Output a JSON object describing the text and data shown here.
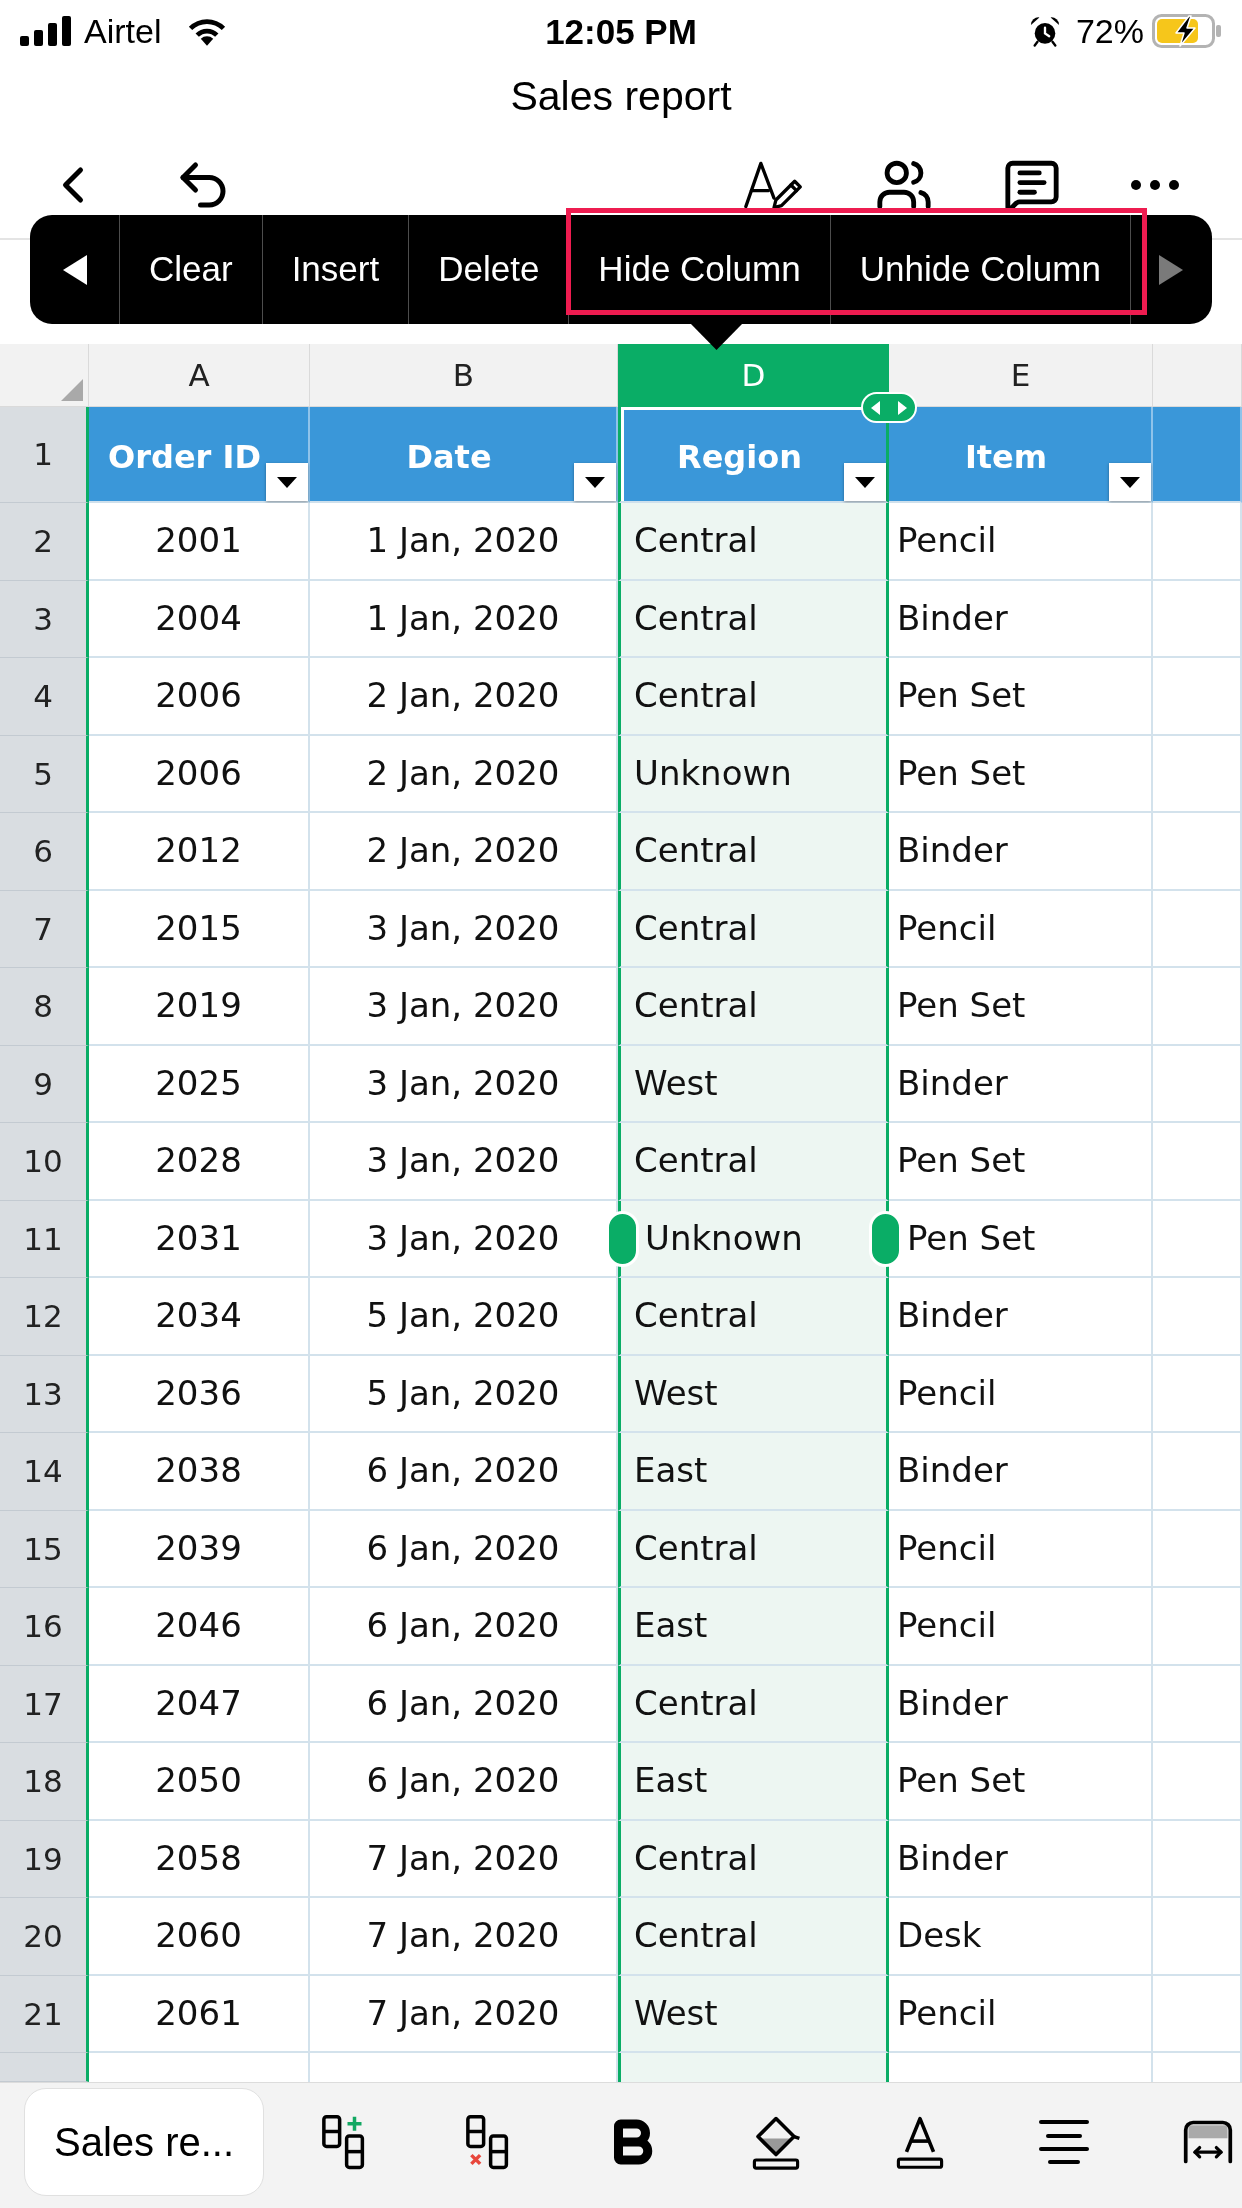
{
  "status_bar": {
    "carrier": "Airtel",
    "time": "12:05 PM",
    "battery": "72%"
  },
  "document": {
    "title": "Sales report"
  },
  "context_menu": {
    "scroll_left": {
      "disabled": false
    },
    "items": [
      {
        "label": "Clear",
        "highlighted": false
      },
      {
        "label": "Insert",
        "highlighted": false
      },
      {
        "label": "Delete",
        "highlighted": false
      },
      {
        "label": "Hide Column",
        "highlighted": true
      },
      {
        "label": "Unhide Column",
        "highlighted": true
      }
    ],
    "scroll_right": {
      "disabled": true
    }
  },
  "sheet": {
    "columns": [
      {
        "letter": "A",
        "selected": false
      },
      {
        "letter": "B",
        "selected": false
      },
      {
        "letter": "D",
        "selected": true
      },
      {
        "letter": "E",
        "selected": false
      },
      {
        "selected": false
      }
    ],
    "rows": [
      {
        "number": "1",
        "kind": "header",
        "handles": false,
        "cells": [
          "Order ID",
          "Date",
          "Region",
          "Item"
        ]
      },
      {
        "number": "2",
        "kind": "data",
        "handles": false,
        "cells": [
          "2001",
          "1 Jan, 2020",
          "Central",
          "Pencil"
        ]
      },
      {
        "number": "3",
        "kind": "data",
        "handles": false,
        "cells": [
          "2004",
          "1 Jan, 2020",
          "Central",
          "Binder"
        ]
      },
      {
        "number": "4",
        "kind": "data",
        "handles": false,
        "cells": [
          "2006",
          "2 Jan, 2020",
          "Central",
          "Pen Set"
        ]
      },
      {
        "number": "5",
        "kind": "data",
        "handles": false,
        "cells": [
          "2006",
          "2 Jan, 2020",
          "Unknown",
          "Pen Set"
        ]
      },
      {
        "number": "6",
        "kind": "data",
        "handles": false,
        "cells": [
          "2012",
          "2 Jan, 2020",
          "Central",
          "Binder"
        ]
      },
      {
        "number": "7",
        "kind": "data",
        "handles": false,
        "cells": [
          "2015",
          "3 Jan, 2020",
          "Central",
          "Pencil"
        ]
      },
      {
        "number": "8",
        "kind": "data",
        "handles": false,
        "cells": [
          "2019",
          "3 Jan, 2020",
          "Central",
          "Pen Set"
        ]
      },
      {
        "number": "9",
        "kind": "data",
        "handles": false,
        "cells": [
          "2025",
          "3 Jan, 2020",
          "West",
          "Binder"
        ]
      },
      {
        "number": "10",
        "kind": "data",
        "handles": false,
        "cells": [
          "2028",
          "3 Jan, 2020",
          "Central",
          "Pen Set"
        ]
      },
      {
        "number": "11",
        "kind": "data",
        "handles": true,
        "cells": [
          "2031",
          "3 Jan, 2020",
          "Unknown",
          "Pen Set"
        ]
      },
      {
        "number": "12",
        "kind": "data",
        "handles": false,
        "cells": [
          "2034",
          "5 Jan, 2020",
          "Central",
          "Binder"
        ]
      },
      {
        "number": "13",
        "kind": "data",
        "handles": false,
        "cells": [
          "2036",
          "5 Jan, 2020",
          "West",
          "Pencil"
        ]
      },
      {
        "number": "14",
        "kind": "data",
        "handles": false,
        "cells": [
          "2038",
          "6 Jan, 2020",
          "East",
          "Binder"
        ]
      },
      {
        "number": "15",
        "kind": "data",
        "handles": false,
        "cells": [
          "2039",
          "6 Jan, 2020",
          "Central",
          "Pencil"
        ]
      },
      {
        "number": "16",
        "kind": "data",
        "handles": false,
        "cells": [
          "2046",
          "6 Jan, 2020",
          "East",
          "Pencil"
        ]
      },
      {
        "number": "17",
        "kind": "data",
        "handles": false,
        "cells": [
          "2047",
          "6 Jan, 2020",
          "Central",
          "Binder"
        ]
      },
      {
        "number": "18",
        "kind": "data",
        "handles": false,
        "cells": [
          "2050",
          "6 Jan, 2020",
          "East",
          "Pen Set"
        ]
      },
      {
        "number": "19",
        "kind": "data",
        "handles": false,
        "cells": [
          "2058",
          "7 Jan, 2020",
          "Central",
          "Binder"
        ]
      },
      {
        "number": "20",
        "kind": "data",
        "handles": false,
        "cells": [
          "2060",
          "7 Jan, 2020",
          "Central",
          "Desk"
        ]
      },
      {
        "number": "21",
        "kind": "data",
        "handles": false,
        "cells": [
          "2061",
          "7 Jan, 2020",
          "West",
          "Pencil"
        ]
      }
    ]
  },
  "sheet_tabs": [
    {
      "label": "Sales re...",
      "selected": true
    }
  ]
}
